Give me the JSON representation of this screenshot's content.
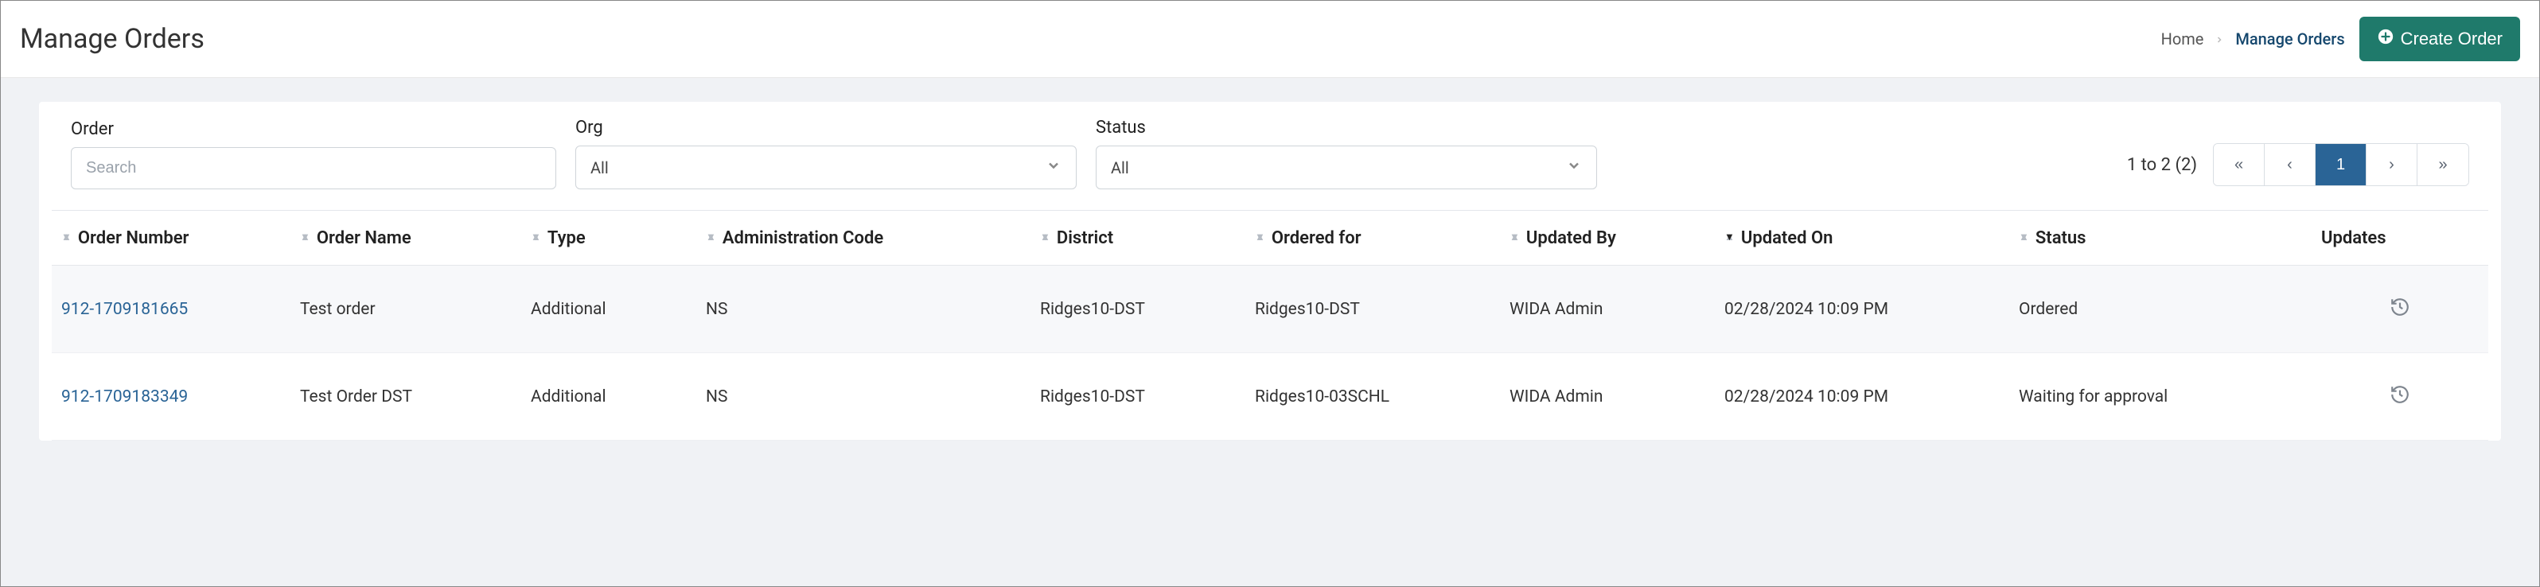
{
  "header": {
    "title": "Manage Orders",
    "breadcrumb": {
      "home": "Home",
      "current": "Manage Orders"
    },
    "create_label": "Create Order"
  },
  "filters": {
    "order": {
      "label": "Order",
      "placeholder": "Search"
    },
    "org": {
      "label": "Org",
      "value": "All"
    },
    "status": {
      "label": "Status",
      "value": "All"
    }
  },
  "pagination": {
    "summary": "1 to 2 (2)",
    "first": "«",
    "prev": "‹",
    "page": "1",
    "next": "›",
    "last": "»"
  },
  "columns": {
    "order_number": "Order Number",
    "order_name": "Order Name",
    "type": "Type",
    "admin_code": "Administration Code",
    "district": "District",
    "ordered_for": "Ordered for",
    "updated_by": "Updated By",
    "updated_on": "Updated On",
    "status": "Status",
    "updates": "Updates"
  },
  "rows": [
    {
      "order_number": "912-1709181665",
      "order_name": "Test order",
      "type": "Additional",
      "admin_code": "NS",
      "district": "Ridges10-DST",
      "ordered_for": "Ridges10-DST",
      "updated_by": "WIDA Admin",
      "updated_on": "02/28/2024 10:09 PM",
      "status": "Ordered"
    },
    {
      "order_number": "912-1709183349",
      "order_name": "Test Order DST",
      "type": "Additional",
      "admin_code": "NS",
      "district": "Ridges10-DST",
      "ordered_for": "Ridges10-03SCHL",
      "updated_by": "WIDA Admin",
      "updated_on": "02/28/2024 10:09 PM",
      "status": "Waiting for approval"
    }
  ]
}
